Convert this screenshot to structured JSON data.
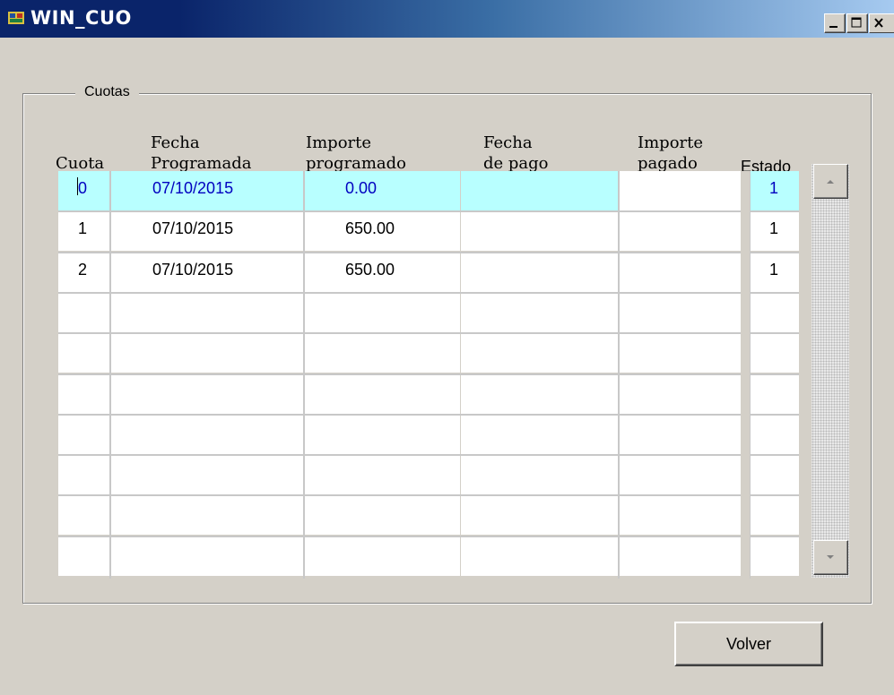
{
  "window": {
    "title": "WIN_CUO",
    "controls": {
      "minimize": "_",
      "maximize": "□",
      "close": "×"
    }
  },
  "frame": {
    "label": "Cuotas"
  },
  "table": {
    "headers": {
      "cuota": [
        "",
        "Cuota"
      ],
      "fecha_programada": [
        "Fecha",
        "Programada"
      ],
      "importe_programado": [
        "Importe",
        "programado"
      ],
      "fecha_pago": [
        "Fecha",
        "de pago"
      ],
      "importe_pagado": [
        "Importe",
        "pagado"
      ],
      "estado": [
        "",
        "Estado"
      ]
    },
    "selected_row": 0,
    "rows": [
      [
        "0",
        "07/10/2015",
        "0.00",
        "",
        "",
        "1"
      ],
      [
        "1",
        "07/10/2015",
        "650.00",
        "",
        "",
        "1"
      ],
      [
        "2",
        "07/10/2015",
        "650.00",
        "",
        "",
        "1"
      ],
      [
        "",
        "",
        "",
        "",
        "",
        ""
      ],
      [
        "",
        "",
        "",
        "",
        "",
        ""
      ],
      [
        "",
        "",
        "",
        "",
        "",
        ""
      ],
      [
        "",
        "",
        "",
        "",
        "",
        ""
      ],
      [
        "",
        "",
        "",
        "",
        "",
        ""
      ],
      [
        "",
        "",
        "",
        "",
        "",
        ""
      ],
      [
        "",
        "",
        "",
        "",
        "",
        ""
      ]
    ]
  },
  "scrollbar": {
    "up_icon": "scroll-up-arrow",
    "down_icon": "scroll-down-arrow"
  },
  "buttons": {
    "volver": "Volver"
  },
  "colors": {
    "selected_row": "#b8ffff",
    "selected_text": "#0000c0",
    "title_bar": "#0a246a"
  }
}
